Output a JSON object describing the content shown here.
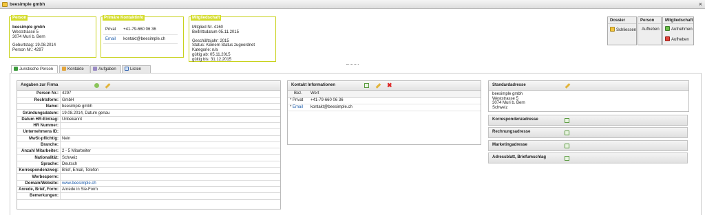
{
  "window": {
    "title": "beesimple gmbh",
    "close": "×"
  },
  "person_box": {
    "header": "Person",
    "name": "beesimple gmbh",
    "street": "Weststrasse 5",
    "city": "3074 Muri b. Bern",
    "birthday": "Geburtstag: 19.08.2014",
    "number": "Person Nr.: 4297"
  },
  "contact_box": {
    "header": "Primäre Kontaktinfo",
    "rows": [
      {
        "type": "Privat",
        "value": "+41-79-660 06 36"
      },
      {
        "type": "Email",
        "value": "kontakt@beesimple.ch"
      }
    ]
  },
  "membership_box": {
    "header": "Mitgliedschaft",
    "lines": [
      "Mitglied Nr. 4160",
      "Beitrittsdatum 05.11.2015",
      "",
      "Geschäftsjahr: 2015",
      "Status: Keinem Status zugeordnet",
      "Kategorie: n/a",
      "gültig ab: 05.11.2015",
      "gültig bis: 31.12.2015"
    ]
  },
  "actions": {
    "dossier": {
      "title": "Dossier",
      "btn": "Schliessen"
    },
    "person": {
      "title": "Person",
      "btn": "Aufheben"
    },
    "mitglied": {
      "title": "Mitgliedschaft",
      "btn1": "Aufnehmen",
      "btn2": "Aufheben"
    }
  },
  "tabs": [
    "Juristische Person",
    "Kontakte",
    "Aufgaben",
    "Listen"
  ],
  "firma": {
    "title": "Angaben zur Firma",
    "rows": [
      {
        "label": "Person Nr.:",
        "value": "4297"
      },
      {
        "label": "Rechtsform:",
        "value": "GmbH"
      },
      {
        "label": "Name:",
        "value": "beesimple gmbh"
      },
      {
        "label": "Gründungsdatum:",
        "value": "19.08.2014, Datum genau"
      },
      {
        "label": "Datum HR-Eintrag:",
        "value": "Unbekannt"
      },
      {
        "label": "HR Nummer:",
        "value": ""
      },
      {
        "label": "Unternehmens ID:",
        "value": ""
      },
      {
        "label": "MwSt-pflichtig:",
        "value": "Nein"
      },
      {
        "label": "Branche:",
        "value": ""
      },
      {
        "label": "Anzahl Mitarbeiter:",
        "value": "2 - 5 Mitarbeiter"
      },
      {
        "label": "Nationalität:",
        "value": "Schweiz"
      },
      {
        "label": "Sprache:",
        "value": "Deutsch"
      },
      {
        "label": "Korrespondenzweg:",
        "value": "Brief, Email, Telefon"
      },
      {
        "label": "Werbesperre:",
        "value": ""
      },
      {
        "label": "Domain/Website:",
        "value": "www.beesimple.ch"
      },
      {
        "label": "Anrede, Brief, Form:",
        "value": "Anrede in Sie-Form"
      },
      {
        "label": "Bemerkungen:",
        "value": ""
      }
    ]
  },
  "kontakt": {
    "title": "Kontakt Informationen",
    "col1": "Bez.",
    "col2": "Wert",
    "rows": [
      {
        "marker": "*",
        "type": "Privat",
        "value": "+41-79-660 06 36"
      },
      {
        "marker": "*",
        "type": "Email",
        "value": "kontakt@beesimple.ch"
      }
    ]
  },
  "addresses": {
    "standard": {
      "title": "Standardadresse",
      "lines": [
        "beesimple gmbh",
        "Weststrasse 5",
        "3074 Muri b. Bern",
        "Schweiz"
      ]
    },
    "others": [
      "Korrespondenzadresse",
      "Rechnungsadresse",
      "Marketingadresse",
      "Adressblatt, Briefumschlag"
    ]
  }
}
